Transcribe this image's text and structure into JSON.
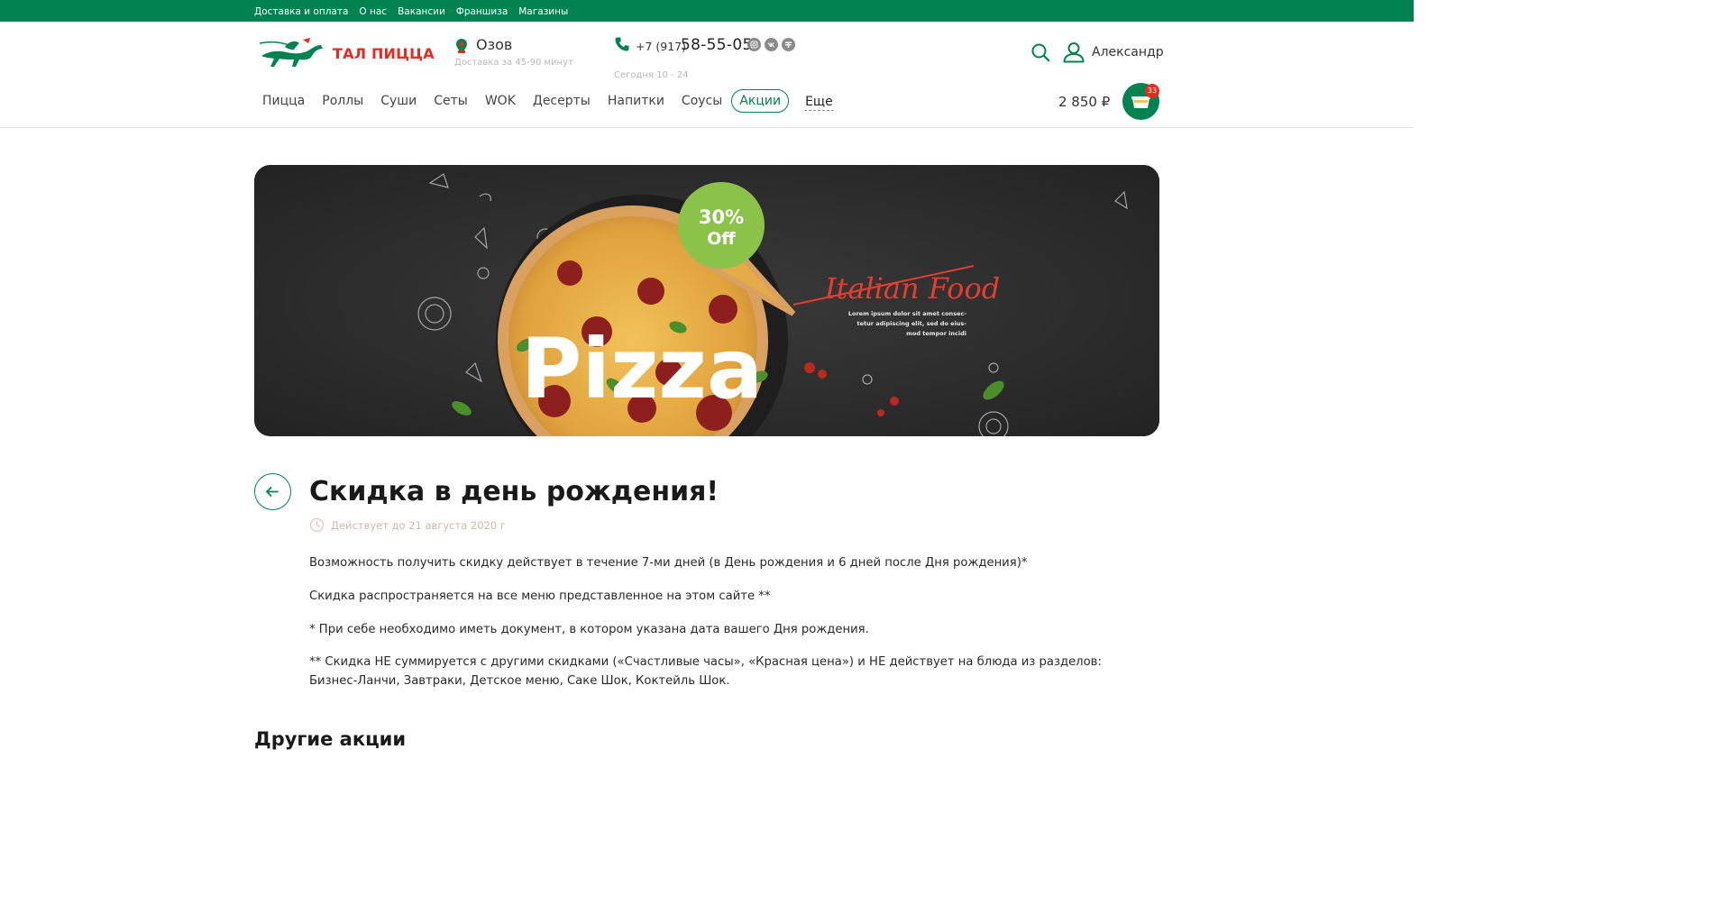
{
  "topbar": {
    "links": [
      "Доставка и оплата",
      "О нас",
      "Вакансии",
      "Франшиза",
      "Магазины"
    ]
  },
  "header": {
    "logo_text": "ТАЛ ПИЦЦА",
    "city": "Озов",
    "delivery_time": "Доставка за 45-90 минут",
    "phone_prefix": "+7 (917)",
    "phone_main": "58-55-05",
    "hours": "Сегодня 10 - 24",
    "user_name": "Александр",
    "social_icons": [
      "instagram-icon",
      "vk-icon",
      "facebook-icon"
    ]
  },
  "nav": {
    "items": [
      "Пицца",
      "Роллы",
      "Суши",
      "Сеты",
      "WOK",
      "Десерты",
      "Напитки",
      "Соусы",
      "Акции"
    ],
    "active": "Акции",
    "more_label": "Еще"
  },
  "cart": {
    "sum": "2 850 ₽",
    "count": "33"
  },
  "banner": {
    "discount_line1": "30%",
    "discount_line2": "Off",
    "script_text": "Italian Food",
    "lorem": [
      "Lorem ipsum dolor sit amet consec-",
      "tetur adipiscing elit, sed do eius-",
      "mod tempor incidi"
    ],
    "big_word": "Pizza"
  },
  "promo": {
    "title": "Скидка в день рождения!",
    "valid_until": "Действует до 21 августа 2020 г",
    "paragraphs": [
      "Возможность получить скидку действует в течение 7-ми дней (в День рождения и 6 дней после Дня рождения)*",
      "Скидка распространяется на все меню представленное на этом сайте **",
      "* При себе необходимо иметь документ, в котором указана дата вашего Дня рождения.",
      "** Скидка НЕ суммируется с другими скидками («Счастливые часы», «Красная цена») и НЕ действует на блюда из разделов: Бизнес-Ланчи, Завтраки, Детское меню, Саке Шок, Коктейль Шок."
    ]
  },
  "others_title": "Другие акции",
  "colors": {
    "brand_green": "#008351",
    "brand_red": "#e62a1d"
  }
}
